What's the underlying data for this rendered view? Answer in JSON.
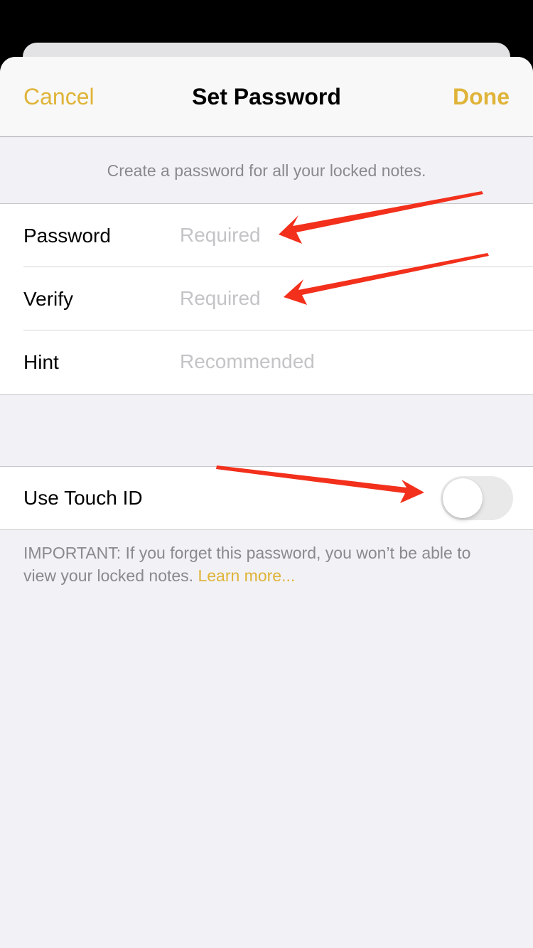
{
  "navbar": {
    "title": "Set Password",
    "cancel_label": "Cancel",
    "done_label": "Done"
  },
  "description": "Create a password for all your locked notes.",
  "fields": [
    {
      "label": "Password",
      "value": "",
      "placeholder": "Required"
    },
    {
      "label": "Verify",
      "value": "",
      "placeholder": "Required"
    },
    {
      "label": "Hint",
      "value": "",
      "placeholder": "Recommended"
    }
  ],
  "touch_id": {
    "label": "Use Touch ID",
    "enabled": false
  },
  "footer": {
    "text": "IMPORTANT: If you forget this password, you won’t be able to view your locked notes.",
    "link_label": "Learn more..."
  },
  "colors": {
    "accent": "#dfb439",
    "annotation_arrow": "#f2301c",
    "background": "#f1f1f6"
  },
  "annotations": [
    "red-arrow-password",
    "red-arrow-verify",
    "red-arrow-touch-id"
  ]
}
